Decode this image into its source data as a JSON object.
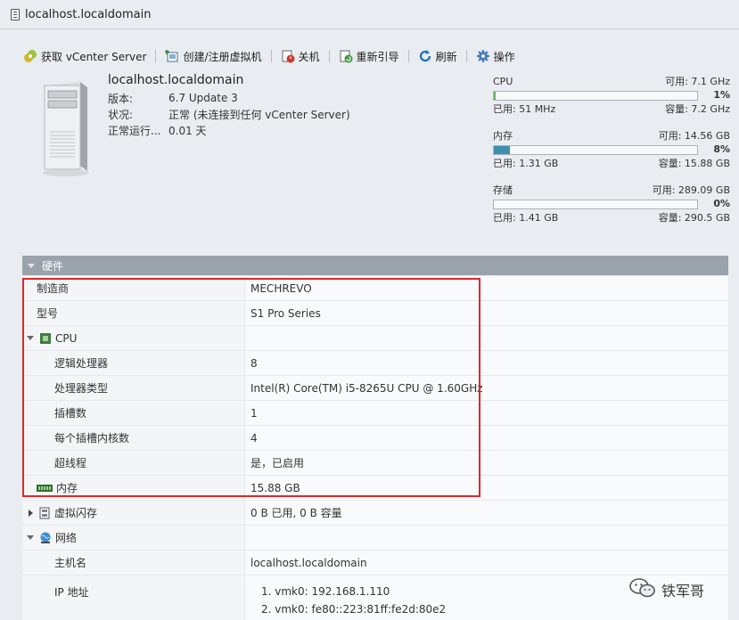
{
  "window": {
    "title": "localhost.localdomain"
  },
  "toolbar": {
    "get_vcenter": "获取 vCenter Server",
    "create_vm": "创建/注册虚拟机",
    "shutdown": "关机",
    "reboot": "重新引导",
    "refresh": "刷新",
    "actions": "操作"
  },
  "host": {
    "name": "localhost.localdomain",
    "version_label": "版本:",
    "version": "6.7 Update 3",
    "state_label": "状况:",
    "state": "正常 (未连接到任何 vCenter Server)",
    "uptime_label": "正常运行...",
    "uptime": "0.01 天"
  },
  "resources": [
    {
      "name": "CPU",
      "free": "可用: 7.1 GHz",
      "percent": 1,
      "percent_text": "1%",
      "used": "已用: 51 MHz",
      "capacity": "容量: 7.2 GHz",
      "color": "#5cb85c"
    },
    {
      "name": "内存",
      "free": "可用: 14.56 GB",
      "percent": 8,
      "percent_text": "8%",
      "used": "已用: 1.31 GB",
      "capacity": "容量: 15.88 GB",
      "color": "#3d8fb0"
    },
    {
      "name": "存储",
      "free": "可用: 289.09 GB",
      "percent": 0,
      "percent_text": "0%",
      "used": "已用: 1.41 GB",
      "capacity": "容量: 290.5 GB",
      "color": "#3d8fb0"
    }
  ],
  "hardware": {
    "header": "硬件",
    "rows": {
      "manufacturer": {
        "label": "制造商",
        "value": "MECHREVO"
      },
      "model": {
        "label": "型号",
        "value": "S1 Pro Series"
      },
      "cpu": {
        "label": "CPU",
        "value": ""
      },
      "logical": {
        "label": "逻辑处理器",
        "value": "8"
      },
      "cpu_type": {
        "label": "处理器类型",
        "value": "Intel(R) Core(TM) i5-8265U CPU @ 1.60GHz"
      },
      "sockets": {
        "label": "插槽数",
        "value": "1"
      },
      "cores": {
        "label": "每个插槽内核数",
        "value": "4"
      },
      "ht": {
        "label": "超线程",
        "value": "是，已启用"
      },
      "memory": {
        "label": "内存",
        "value": "15.88 GB"
      },
      "vflash": {
        "label": "虚拟闪存",
        "value": "0 B 已用, 0 B 容量"
      },
      "network": {
        "label": "网络",
        "value": ""
      },
      "hostname": {
        "label": "主机名",
        "value": "localhost.localdomain"
      },
      "ip": {
        "label": "IP 地址",
        "values": [
          "1. vmk0: 192.168.1.110",
          "2. vmk0: fe80::223:81ff:fe2d:80e2"
        ]
      }
    }
  },
  "watermark": {
    "text": "铁军哥"
  }
}
